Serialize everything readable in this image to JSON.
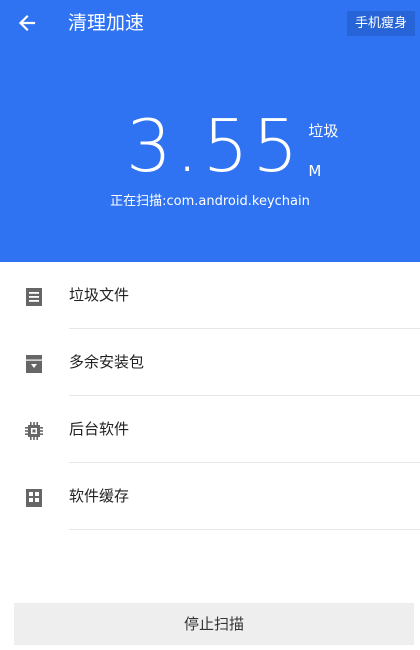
{
  "header": {
    "title": "清理加速",
    "action_label": "手机瘦身"
  },
  "scan": {
    "amount": "3.55",
    "unit_label": "垃圾",
    "unit": "M",
    "status": "正在扫描:com.android.keychain"
  },
  "list": {
    "items": [
      {
        "label": "垃圾文件",
        "icon": "document-list-icon"
      },
      {
        "label": "多余安装包",
        "icon": "archive-box-icon"
      },
      {
        "label": "后台软件",
        "icon": "chip-icon"
      },
      {
        "label": "软件缓存",
        "icon": "grid-icon"
      }
    ]
  },
  "footer": {
    "stop_label": "停止扫描"
  },
  "colors": {
    "header_bg": "#2f73f3",
    "icon": "#666666"
  }
}
